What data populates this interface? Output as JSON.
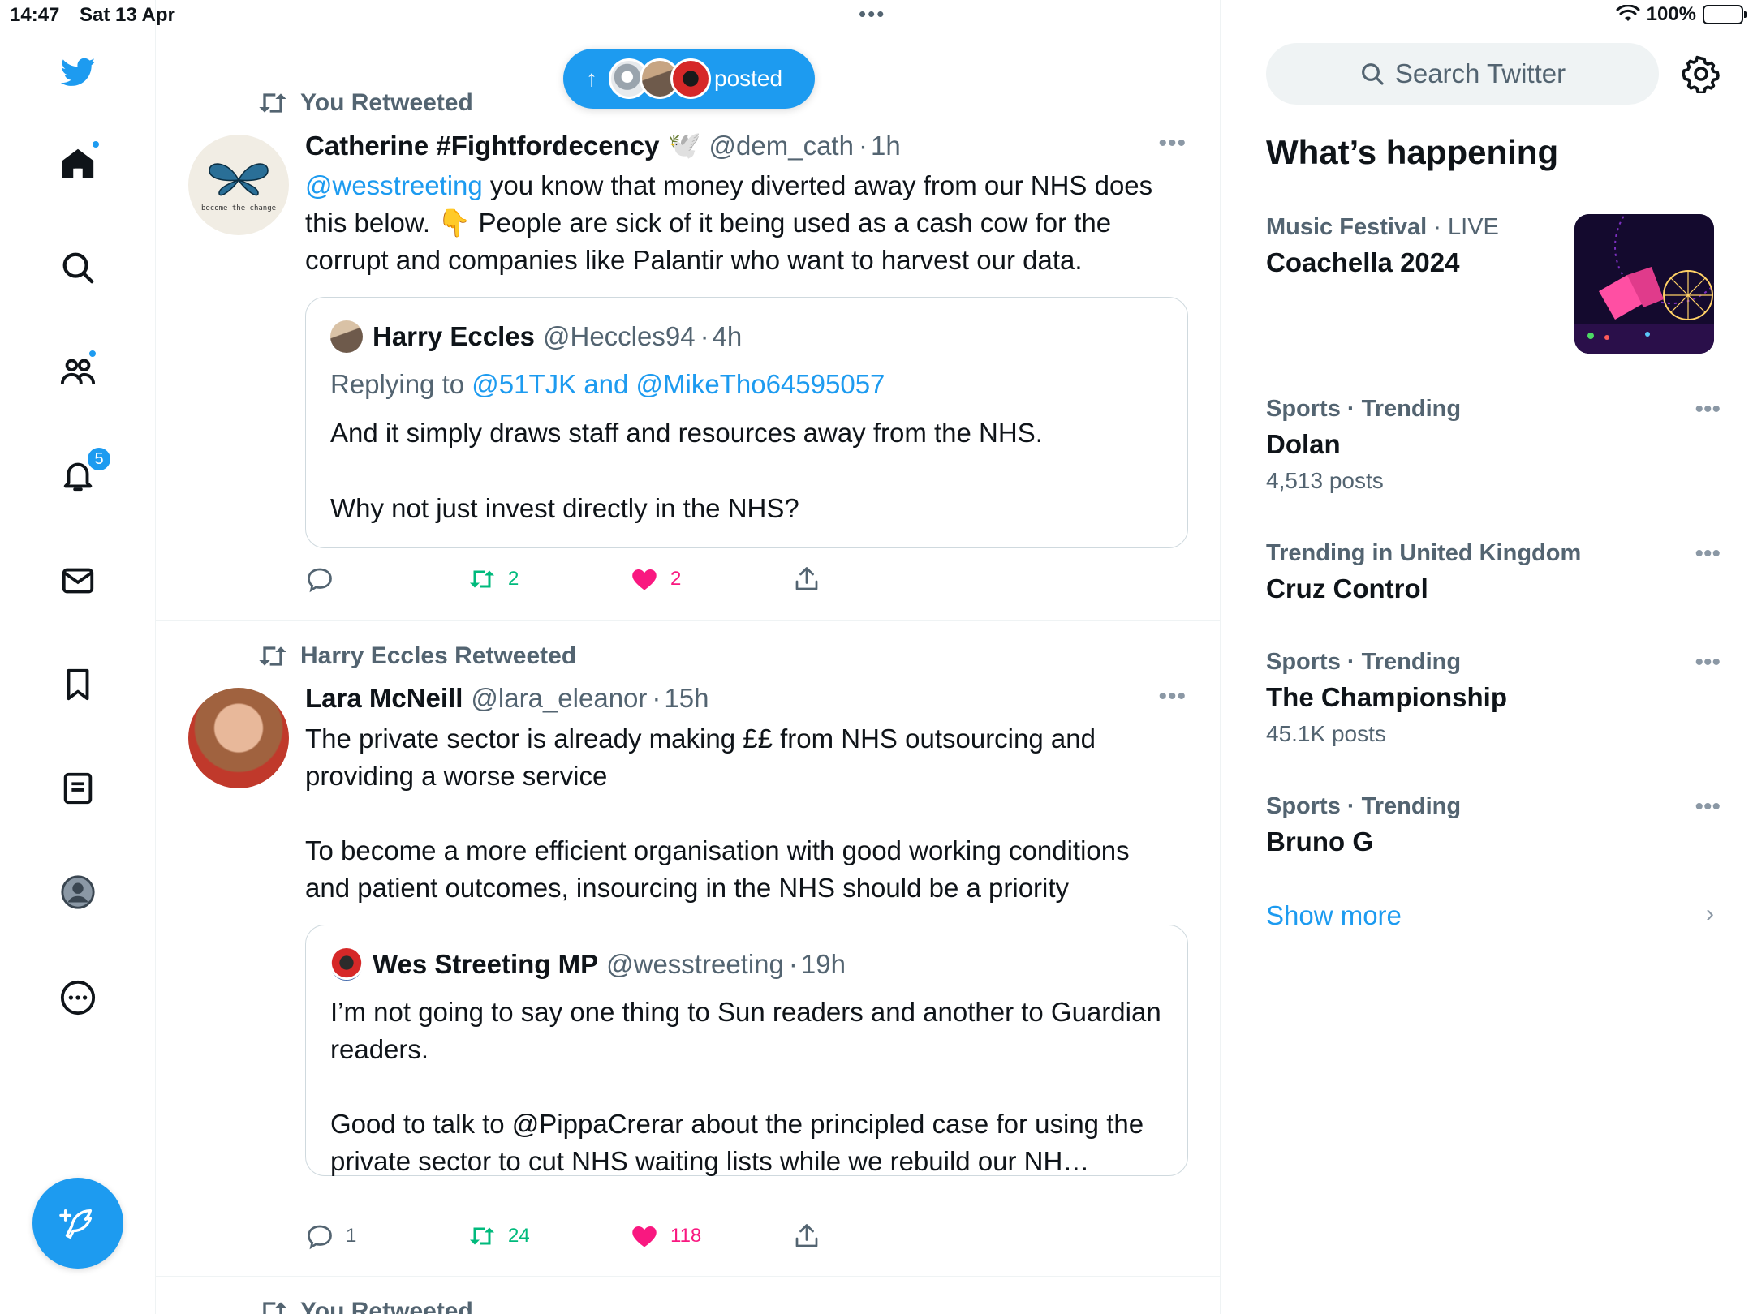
{
  "status_bar": {
    "time": "14:47",
    "date": "Sat 13 Apr",
    "dots": "•••",
    "battery": "100%"
  },
  "nav": {
    "notifications_badge": "5"
  },
  "feed": {
    "posted_pill": {
      "label": "posted",
      "arrow": "↑"
    },
    "tweets": [
      {
        "context": "You Retweeted",
        "name": "Catherine #Fightfordecency",
        "emoji": "🕊️",
        "handle": "@dem_cath",
        "time": "1h",
        "avatar_text": "become the change",
        "mention": "@wesstreeting",
        "text_rest": " you know that money diverted away from our NHS does this below. 👇 People are sick of it being used as a cash cow for the corrupt and companies like Palantir who want to harvest our data.",
        "quote": {
          "name": "Harry Eccles",
          "handle": "@Heccles94",
          "time": "4h",
          "replying_prefix": "Replying to ",
          "replying_to": "@51TJK and @MikeTho64595057",
          "text1": "And it simply draws staff and resources away from the NHS.",
          "text2": "Why not just invest directly in the NHS?"
        },
        "actions": {
          "replies": "",
          "retweets": "2",
          "likes": "2"
        }
      },
      {
        "context": "Harry Eccles Retweeted",
        "name": "Lara McNeill",
        "handle": "@lara_eleanor",
        "time": "15h",
        "text1": "The private sector is already making ££ from NHS outsourcing and providing a worse service",
        "text2": "To become a more efficient organisation with good working conditions and patient outcomes, insourcing in the NHS should be a priority",
        "quote": {
          "name": "Wes Streeting MP",
          "handle": "@wesstreeting",
          "time": "19h",
          "text1": "I’m not going to say one thing to Sun readers and another to Guardian readers.",
          "text2": "Good to talk to @PippaCrerar about the principled case for using the private sector to cut NHS waiting lists while we rebuild our NH…"
        },
        "actions": {
          "replies": "1",
          "retweets": "24",
          "likes": "118"
        }
      },
      {
        "context": "You Retweeted"
      }
    ]
  },
  "sidebar": {
    "search_placeholder": "Search Twitter",
    "heading": "What’s happening",
    "trends": [
      {
        "category": "Music Festival",
        "sep": " · ",
        "status": "LIVE",
        "topic": "Coachella 2024",
        "count": ""
      },
      {
        "category": "Sports · Trending",
        "topic": "Dolan",
        "count": "4,513 posts"
      },
      {
        "category": "Trending in United Kingdom",
        "topic": "Cruz Control",
        "count": ""
      },
      {
        "category": "Sports · Trending",
        "topic": "The Championship",
        "count": "45.1K posts"
      },
      {
        "category": "Sports · Trending",
        "topic": "Bruno G",
        "count": ""
      }
    ],
    "show_more": "Show more"
  },
  "colors": {
    "accent": "#1d9bf0",
    "retweet": "#00ba7c",
    "like": "#f91880",
    "secondary_text": "#536471"
  }
}
